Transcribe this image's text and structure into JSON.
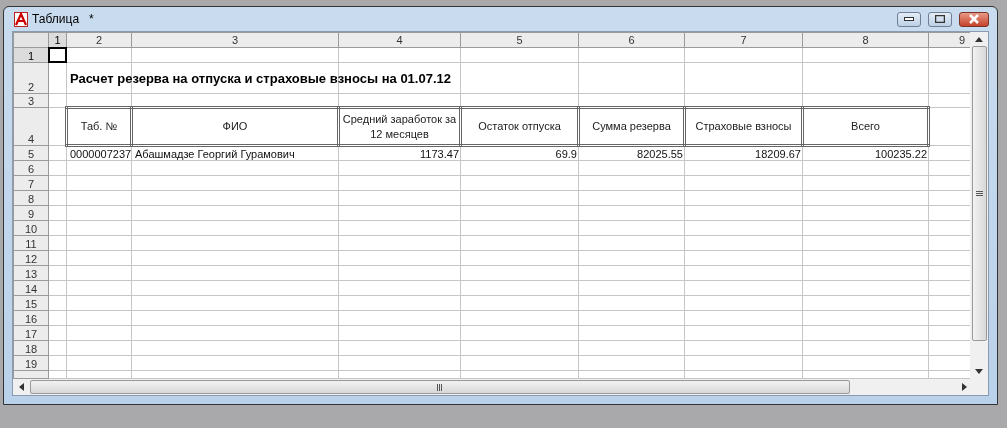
{
  "window": {
    "title": "Таблица",
    "modified_mark": "*"
  },
  "columns": [
    {
      "label": "1",
      "cursor": true
    },
    {
      "label": "2",
      "cursor": false
    },
    {
      "label": "3",
      "cursor": false
    },
    {
      "label": "4",
      "cursor": false
    },
    {
      "label": "5",
      "cursor": false
    },
    {
      "label": "6",
      "cursor": false
    },
    {
      "label": "7",
      "cursor": false
    },
    {
      "label": "8",
      "cursor": false
    },
    {
      "label": "9",
      "cursor": false
    }
  ],
  "rows": [
    {
      "label": "1",
      "cursor": true
    },
    {
      "label": "2",
      "cursor": false
    },
    {
      "label": "3",
      "cursor": false
    },
    {
      "label": "4",
      "cursor": false
    },
    {
      "label": "5",
      "cursor": false
    },
    {
      "label": "6",
      "cursor": false
    },
    {
      "label": "7",
      "cursor": false
    },
    {
      "label": "8",
      "cursor": false
    },
    {
      "label": "9",
      "cursor": false
    },
    {
      "label": "10",
      "cursor": false
    },
    {
      "label": "11",
      "cursor": false
    },
    {
      "label": "12",
      "cursor": false
    },
    {
      "label": "13",
      "cursor": false
    },
    {
      "label": "14",
      "cursor": false
    },
    {
      "label": "15",
      "cursor": false
    },
    {
      "label": "16",
      "cursor": false
    },
    {
      "label": "17",
      "cursor": false
    },
    {
      "label": "18",
      "cursor": false
    },
    {
      "label": "19",
      "cursor": false
    }
  ],
  "report": {
    "title": "Расчет резерва на отпуска и страховые взносы на 01.07.12",
    "headers": [
      "Таб. №",
      "ФИО",
      "Средний заработок за 12 месяцев",
      "Остаток отпуска",
      "Сумма резерва",
      "Страховые взносы",
      "Всего"
    ],
    "rows": [
      {
        "cells": [
          "0000007237",
          "Абашмадзе Георгий Гурамович",
          "1173.47",
          "69.9",
          "82025.55",
          "18209.67",
          "100235.22"
        ]
      }
    ]
  }
}
